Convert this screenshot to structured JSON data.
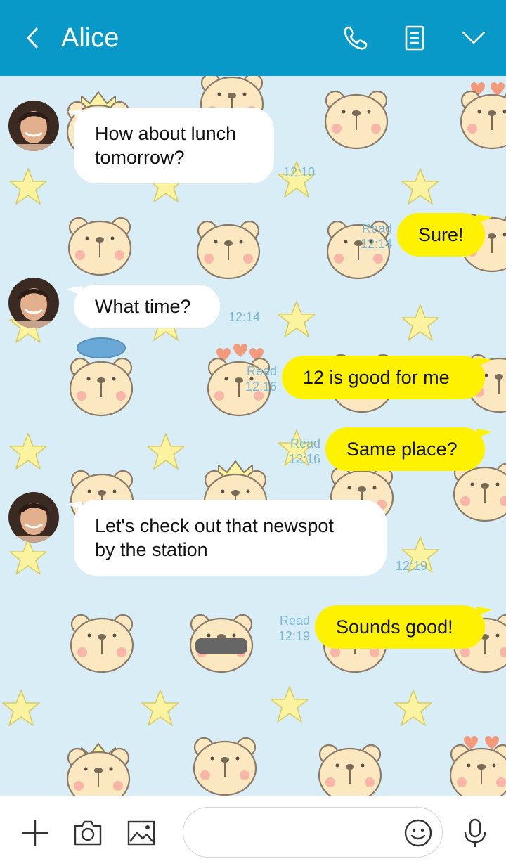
{
  "header": {
    "title": "Alice",
    "background": "#0899c8",
    "icons": [
      "back-icon",
      "phone-icon",
      "notes-icon",
      "chevron-down-icon"
    ]
  },
  "messages": [
    {
      "side": "in",
      "text": "How about lunch\ntomorrow?",
      "time": "12:10",
      "read": ""
    },
    {
      "side": "out",
      "text": "Sure!",
      "time": "12:14",
      "read": "Read"
    },
    {
      "side": "in",
      "text": "What time?",
      "time": "12:14",
      "read": ""
    },
    {
      "side": "out",
      "text": "12 is good for me",
      "time": "12:16",
      "read": "Read"
    },
    {
      "side": "out",
      "text": "Same place?",
      "time": "12:16",
      "read": "Read"
    },
    {
      "side": "in",
      "text": "Let's check out that newspot\nby the station",
      "time": "12:19",
      "read": ""
    },
    {
      "side": "out",
      "text": "Sounds good!",
      "time": "12:19",
      "read": "Read"
    }
  ],
  "input": {
    "placeholder": "",
    "icons": [
      "plus-icon",
      "camera-icon",
      "image-icon",
      "emoji-icon",
      "microphone-icon"
    ]
  },
  "colors": {
    "incoming_bubble": "#ffffff",
    "outgoing_bubble": "#fff200",
    "chat_background": "#d9edf6",
    "meta_text": "#7ab7d6"
  }
}
